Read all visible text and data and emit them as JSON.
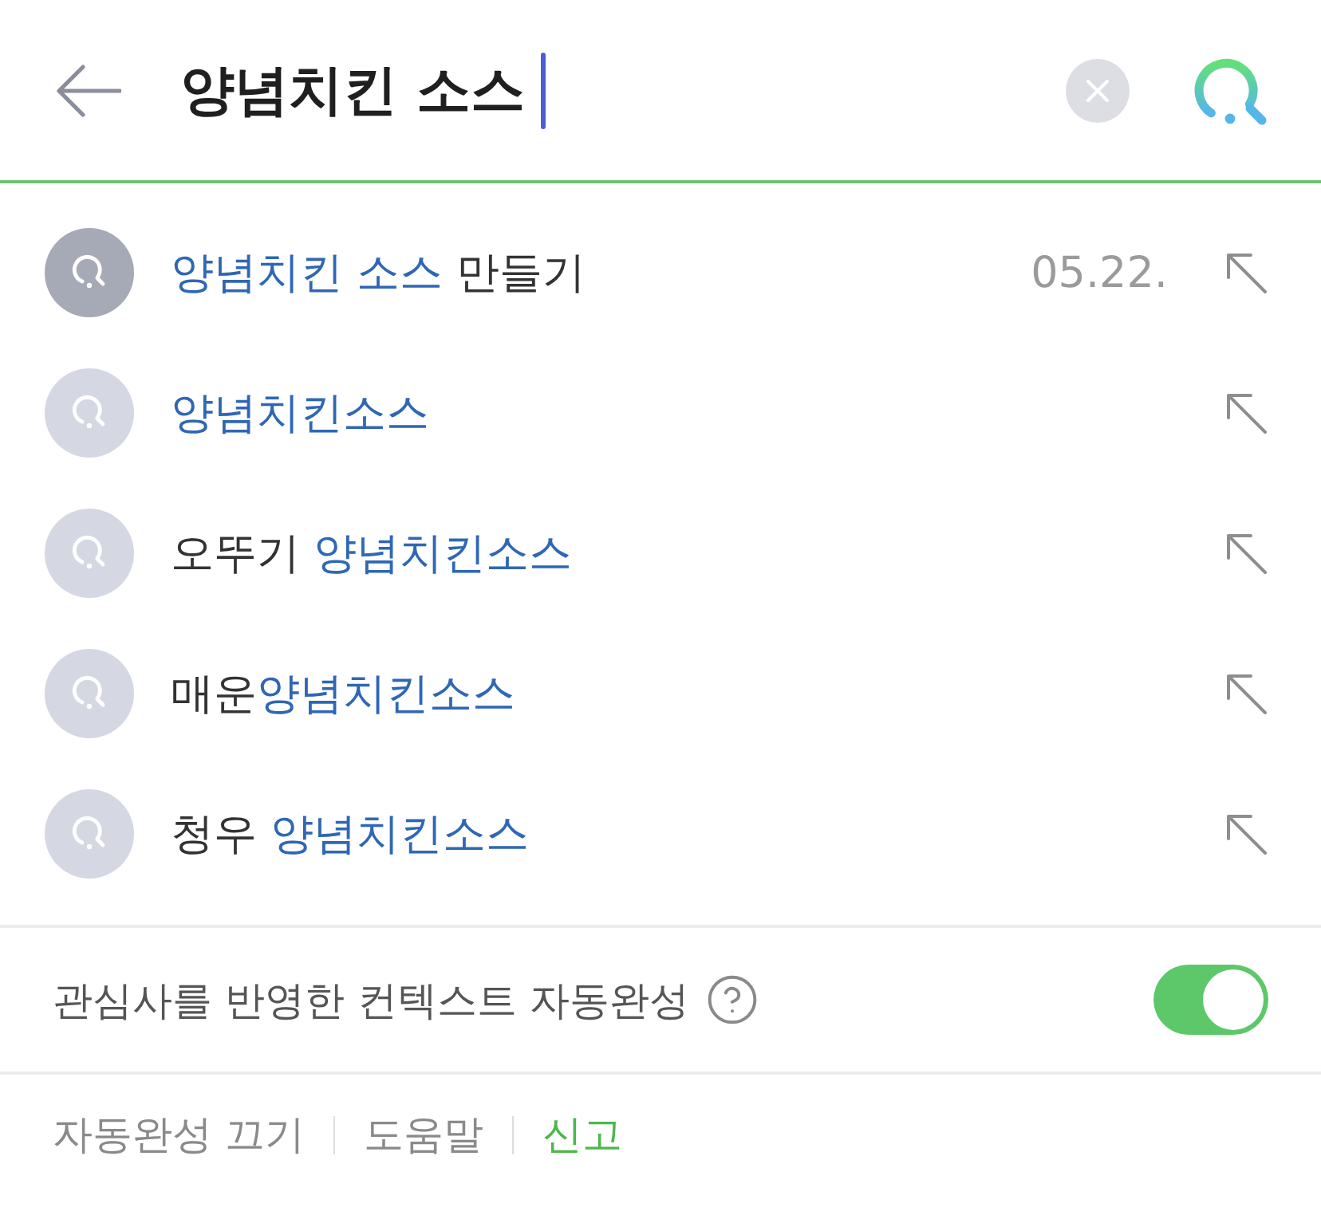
{
  "header": {
    "query": "양념치킨 소스"
  },
  "suggestions": [
    {
      "kind": "history",
      "parts": [
        {
          "text": "양념치킨 소스",
          "highlight": true
        },
        {
          "text": " 만들기",
          "highlight": false
        }
      ],
      "date": "05.22."
    },
    {
      "kind": "suggestion",
      "parts": [
        {
          "text": "양념치킨소스",
          "highlight": true
        }
      ]
    },
    {
      "kind": "suggestion",
      "parts": [
        {
          "text": "오뚜기 ",
          "highlight": false
        },
        {
          "text": "양념치킨소스",
          "highlight": true
        }
      ]
    },
    {
      "kind": "suggestion",
      "parts": [
        {
          "text": "매운",
          "highlight": false
        },
        {
          "text": "양념치킨소스",
          "highlight": true
        }
      ]
    },
    {
      "kind": "suggestion",
      "parts": [
        {
          "text": "청우 ",
          "highlight": false
        },
        {
          "text": "양념치킨소스",
          "highlight": true
        }
      ]
    }
  ],
  "context_autocomplete": {
    "label": "관심사를 반영한 컨텍스트 자동완성",
    "on": true
  },
  "footer_links": [
    {
      "label": "자동완성 끄기",
      "accent": false
    },
    {
      "label": "도움말",
      "accent": false
    },
    {
      "label": "신고",
      "accent": true
    }
  ]
}
